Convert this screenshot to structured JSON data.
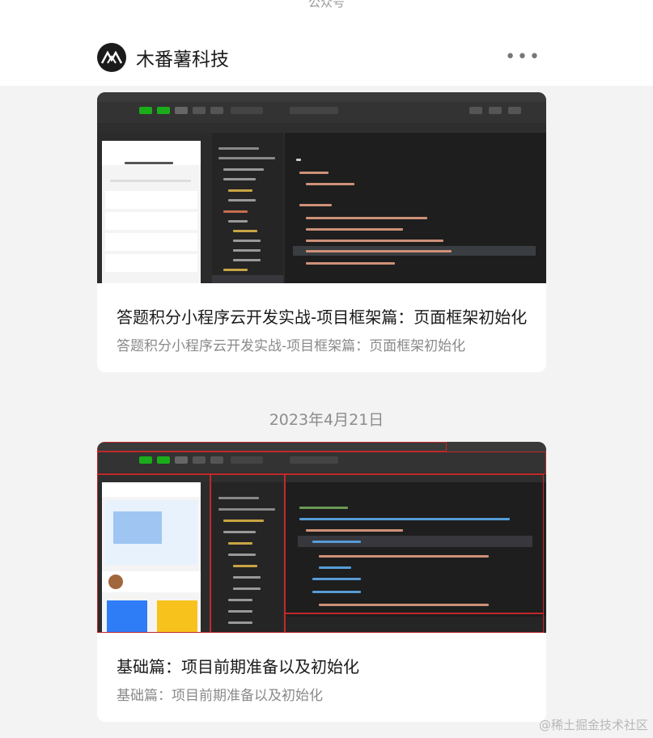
{
  "header": {
    "top_label": "公众号",
    "account_name": "木番薯科技",
    "more_icon": "more-icon"
  },
  "articles": [
    {
      "title": "答题积分小程序云开发实战-项目框架篇：页面框架初始化",
      "subtitle": "答题积分小程序云开发实战-项目框架篇：页面框架初始化"
    },
    {
      "title": "基础篇：项目前期准备以及初始化",
      "subtitle": "基础篇：项目前期准备以及初始化"
    }
  ],
  "date_separator": "2023年4月21日",
  "watermark": "@稀土掘金技术社区",
  "colors": {
    "background": "#f3f3f3",
    "card": "#ffffff",
    "ide_dark": "#1e1e1e",
    "accent_green": "#1aad19"
  }
}
